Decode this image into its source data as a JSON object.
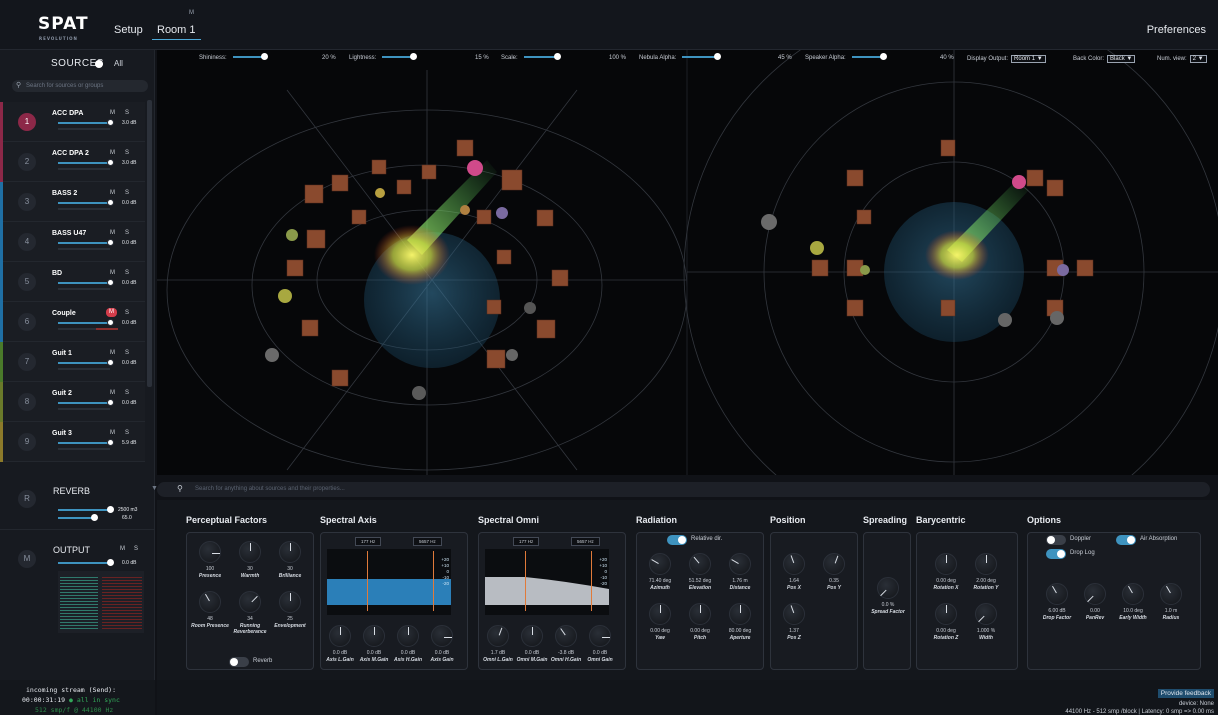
{
  "app": {
    "logo": "SPAT",
    "logo_sub": "REVOLUTION",
    "tab_setup": "Setup",
    "tab_room": "Room 1",
    "tab_room_marker": "M",
    "preferences": "Preferences"
  },
  "sidebar": {
    "title": "SOURCES",
    "all_label": "All",
    "search_placeholder": "Search for sources or groups",
    "sources": [
      {
        "num": "1",
        "name": "ACC DPA",
        "m": "M",
        "s": "S",
        "db": "3.0 dB",
        "color": "#8c2848"
      },
      {
        "num": "2",
        "name": "ACC DPA 2",
        "m": "M",
        "s": "S",
        "db": "3.0 dB",
        "color": "#8c2848"
      },
      {
        "num": "3",
        "name": "BASS 2",
        "m": "M",
        "s": "S",
        "db": "0.0 dB",
        "color": "#1f6fa4"
      },
      {
        "num": "4",
        "name": "BASS U47",
        "m": "M",
        "s": "S",
        "db": "0.0 dB",
        "color": "#1f6fa4"
      },
      {
        "num": "5",
        "name": "BD",
        "m": "M",
        "s": "S",
        "db": "0.0 dB",
        "color": "#1f6fa4"
      },
      {
        "num": "6",
        "name": "Couple",
        "m": "M",
        "s": "S",
        "db": "0.0 dB",
        "color": "#1f6fa4"
      },
      {
        "num": "7",
        "name": "Guit 1",
        "m": "M",
        "s": "S",
        "db": "0.0 dB",
        "color": "#4a7a2a"
      },
      {
        "num": "8",
        "name": "Guit 2",
        "m": "M",
        "s": "S",
        "db": "0.0 dB",
        "color": "#6a7a2a"
      },
      {
        "num": "9",
        "name": "Guit 3",
        "m": "M",
        "s": "S",
        "db": "5.9 dB",
        "color": "#8c7a2a"
      }
    ],
    "reverb": {
      "badge": "R",
      "title": "REVERB",
      "size": "2500 m3",
      "value": "65.0"
    },
    "output": {
      "badge": "M",
      "title": "OUTPUT",
      "m": "M",
      "s": "S",
      "db": "0.0 dB"
    },
    "status": {
      "line1": "incoming stream (Send):",
      "time": "00:00:31:19",
      "sync": "all in sync",
      "line3": "512 smp/f @ 44100 Hz"
    }
  },
  "viewer": {
    "shininess": {
      "label": "Shininess:",
      "value": "20 %"
    },
    "lightness": {
      "label": "Lightness:",
      "value": "15 %"
    },
    "scale": {
      "label": "Scale:",
      "value": "100 %"
    },
    "nebula": {
      "label": "Nebula Alpha:",
      "value": "45 %"
    },
    "speaker": {
      "label": "Speaker Alpha:",
      "value": "40 %"
    },
    "display_output": {
      "label": "Display Output:",
      "value": "Room 1"
    },
    "back_color": {
      "label": "Back Color:",
      "value": "Black"
    },
    "num_view": {
      "label": "Num. view:",
      "value": "2"
    }
  },
  "props_search_placeholder": "Search for anything about sources and their properties...",
  "perceptual": {
    "title": "Perceptual Factors",
    "knobs": [
      {
        "v": "100",
        "l": "Presence"
      },
      {
        "v": "30",
        "l": "Warmth"
      },
      {
        "v": "30",
        "l": "Brilliance"
      },
      {
        "v": "48",
        "l": "Room Presence"
      },
      {
        "v": "34",
        "l": "Running Reverberance"
      },
      {
        "v": "25",
        "l": "Envelopment"
      }
    ],
    "reverb_toggle": "Reverb"
  },
  "spectral_axis": {
    "title": "Spectral Axis",
    "f1": "177 Hz",
    "f2": "5657 Hz",
    "scale": [
      "+20",
      "+10",
      "0",
      "-10",
      "-20"
    ],
    "knobs": [
      {
        "v": "0.0 dB",
        "l": "Axis L.Gain"
      },
      {
        "v": "0.0 dB",
        "l": "Axis M.Gain"
      },
      {
        "v": "0.0 dB",
        "l": "Axis H.Gain"
      },
      {
        "v": "0.0 dB",
        "l": "Axis Gain"
      }
    ]
  },
  "spectral_omni": {
    "title": "Spectral Omni",
    "f1": "177 Hz",
    "f2": "5657 Hz",
    "scale": [
      "+20",
      "+10",
      "0",
      "-10",
      "-20"
    ],
    "knobs": [
      {
        "v": "1.7 dB",
        "l": "Omni L.Gain"
      },
      {
        "v": "0.0 dB",
        "l": "Omni M.Gain"
      },
      {
        "v": "-3.8 dB",
        "l": "Omni H.Gain"
      },
      {
        "v": "0.0 dB",
        "l": "Omni Gain"
      }
    ]
  },
  "radiation": {
    "title": "Radiation",
    "relative": "Relative dir.",
    "knobs": [
      {
        "v": "71.40 deg",
        "l": "Azimuth"
      },
      {
        "v": "51.52 deg",
        "l": "Elevation"
      },
      {
        "v": "1.76 m",
        "l": "Distance"
      },
      {
        "v": "0.00 deg",
        "l": "Yaw"
      },
      {
        "v": "0.00 deg",
        "l": "Pitch"
      },
      {
        "v": "80.00 deg",
        "l": "Aperture"
      }
    ]
  },
  "position": {
    "title": "Position",
    "knobs": [
      {
        "v": "1.64",
        "l": "Pos X"
      },
      {
        "v": "0.35",
        "l": "Pos Y"
      },
      {
        "v": "1.37",
        "l": "Pos Z"
      }
    ]
  },
  "spreading": {
    "title": "Spreading",
    "v": "0.0 %",
    "l": "Spread Factor"
  },
  "barycentric": {
    "title": "Barycentric",
    "knobs": [
      {
        "v": "0.00 deg",
        "l": "Rotation X"
      },
      {
        "v": "2.00 deg",
        "l": "Rotation Y"
      },
      {
        "v": "0.00 deg",
        "l": "Rotation Z"
      },
      {
        "v": "1.000 %",
        "l": "Width"
      }
    ]
  },
  "options": {
    "title": "Options",
    "doppler": "Doppler",
    "air": "Air Absorption",
    "droplog": "Drop Log",
    "knobs": [
      {
        "v": "6.00 dB",
        "l": "Drop Factor"
      },
      {
        "v": "0.00",
        "l": "PanRev"
      },
      {
        "v": "10.0 deg",
        "l": "Early Width"
      },
      {
        "v": "1.0 m",
        "l": "Radius"
      }
    ]
  },
  "footer": {
    "feedback": "Provide feedback",
    "device": "device: None",
    "latency": "44100 Hz - 512 smp /block | Latency: 0 smp => 0.00 ms"
  }
}
